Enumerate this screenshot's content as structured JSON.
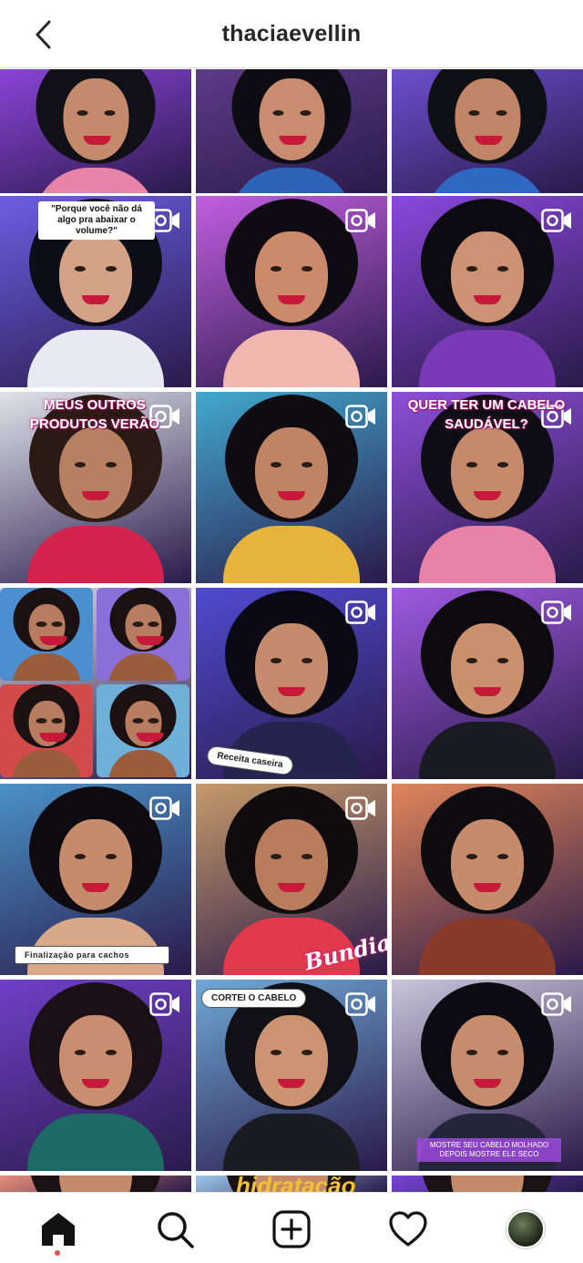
{
  "header": {
    "title": "thaciaevellin"
  },
  "icons": {
    "back": "chevron-left-icon",
    "reel": "reel-video-icon",
    "home": "home-icon",
    "search": "search-icon",
    "new_post": "plus-square-icon",
    "activity": "heart-icon",
    "profile": "avatar"
  },
  "posts": [
    {
      "bg": "#8a44d8",
      "hair": "#101016",
      "skin": "#c48a6c",
      "shirt": "#e983a8",
      "reel": false
    },
    {
      "bg": "#5d3b88",
      "hair": "#0c0c12",
      "skin": "#c98c6f",
      "shirt": "#2d64b8",
      "reel": false
    },
    {
      "bg": "#6d4fd0",
      "hair": "#0f0f16",
      "skin": "#c08567",
      "shirt": "#2f68c2",
      "reel": false
    },
    {
      "bg": "#6b5fe3",
      "hair": "#0d0e18",
      "skin": "#d3a186",
      "shirt": "#e9e9f3",
      "reel": true,
      "quote": "\"Porque você não dá algo pra abaixar o volume?\""
    },
    {
      "bg": "#c15fe0",
      "hair": "#0e0b12",
      "skin": "#cb8b6a",
      "shirt": "#f1b6ae",
      "reel": true
    },
    {
      "bg": "#8b48dc",
      "hair": "#0c0b12",
      "skin": "#cd9174",
      "shirt": "#7a3ab8",
      "reel": true
    },
    {
      "bg": "#dfe3ea",
      "hair": "#2b1a14",
      "skin": "#b88062",
      "shirt": "#d4234e",
      "reel": true,
      "caption": "MEUS OUTROS PRODUTOS VERÃO"
    },
    {
      "bg": "#42a9cf",
      "hair": "#0e0c10",
      "skin": "#be8464",
      "shirt": "#e6b43a",
      "reel": true
    },
    {
      "bg": "#8d4fd8",
      "hair": "#0f0e16",
      "skin": "#c48a6a",
      "shirt": "#e883a7",
      "reel": true,
      "caption": "QUER TER UM CABELO SAUDÁVEL?"
    },
    {
      "bg": "#d9d9e6",
      "hair": "#1b1012",
      "skin": "#b87d60",
      "shirt": "#9a5c3a",
      "reel": false,
      "collage": true
    },
    {
      "bg": "#4f4bd0",
      "hair": "#0b0a14",
      "skin": "#c58b6d",
      "shirt": "#25244f",
      "reel": true,
      "pill": "Receita caseira"
    },
    {
      "bg": "#9f5ae2",
      "hair": "#0d0a10",
      "skin": "#c9916e",
      "shirt": "#1a1a22",
      "reel": true
    },
    {
      "bg": "#4a92c8",
      "hair": "#0d0b10",
      "skin": "#c58b6b",
      "shirt": "#d9a889",
      "reel": true,
      "search_caption": "Finalização para cachos"
    },
    {
      "bg": "#c59a6a",
      "hair": "#100c0e",
      "skin": "#b97c5c",
      "shirt": "#e23a4c",
      "reel": true,
      "script": "Bundia!"
    },
    {
      "bg": "#e0865a",
      "hair": "#0f0c10",
      "skin": "#c58b6b",
      "shirt": "#8a3a2a",
      "reel": false
    },
    {
      "bg": "#7040c8",
      "hair": "#1a1016",
      "skin": "#c98e70",
      "shirt": "#1d6a66",
      "reel": true
    },
    {
      "bg": "#6fa9d6",
      "hair": "#101016",
      "skin": "#cc9373",
      "shirt": "#1b1b22",
      "reel": true,
      "pill": "CORTEI O CABELO"
    },
    {
      "bg": "#c8c5da",
      "hair": "#0c0b12",
      "skin": "#c68c6e",
      "shirt": "#24243a",
      "reel": true,
      "bottom_caption": "MOSTRE SEU CABELO MOLHADO DEPOIS MOSTRE ELE SECO"
    },
    {
      "bg": "#e88f7a",
      "hair": "#1a1214",
      "skin": "#c48a6a",
      "shirt": "#6a3a5a",
      "reel": false
    },
    {
      "bg": "#9cc8ea",
      "hair": "#1a1214",
      "skin": "#c48a6a",
      "shirt": "#4a3a6a",
      "reel": false,
      "hidr": "hidratação"
    },
    {
      "bg": "#7a44d8",
      "hair": "#1a1214",
      "skin": "#c48a6a",
      "shirt": "#6a3a8a",
      "reel": false
    }
  ]
}
